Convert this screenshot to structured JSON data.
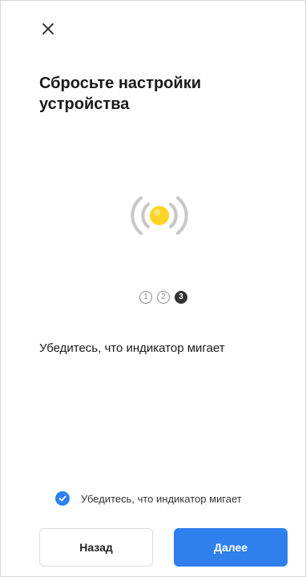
{
  "header": {
    "close_icon": "close-icon",
    "title": "Сбросьте настройки устройства"
  },
  "illustration": {
    "icon": "blinking-indicator-icon",
    "colors": {
      "light": "#ffd324",
      "waves": "#c7c7c7"
    }
  },
  "stepper": {
    "steps": [
      "1",
      "2",
      "3"
    ],
    "current_step": 3
  },
  "content": {
    "instruction": "Убедитесь, что индикатор мигает"
  },
  "confirmation": {
    "checked": true,
    "label": "Убедитесь, что индикатор мигает"
  },
  "footer": {
    "back_label": "Назад",
    "next_label": "Далее"
  },
  "colors": {
    "accent": "#2f80ed"
  }
}
